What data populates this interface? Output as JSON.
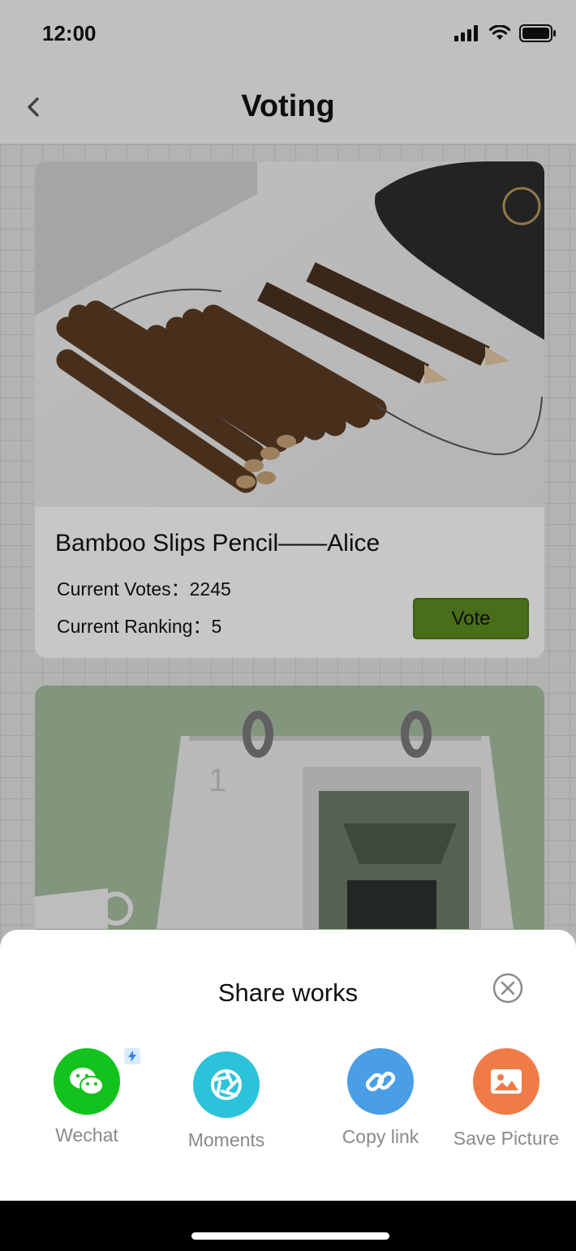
{
  "status_bar": {
    "time": "12:00"
  },
  "nav": {
    "title": "Voting"
  },
  "cards": [
    {
      "title": "Bamboo Slips Pencil——Alice",
      "votes_text": "Current Votes：2245",
      "ranking_text": "Current Ranking：5",
      "vote_label": "Vote"
    },
    {
      "image": "desk-calendar-photo"
    }
  ],
  "share_sheet": {
    "title": "Share works",
    "items": [
      {
        "label": "Wechat",
        "icon": "wechat-icon",
        "color": "#13c21c"
      },
      {
        "label": "Moments",
        "icon": "moments-icon",
        "color": "#2bc3d9"
      },
      {
        "label": "Copy link",
        "icon": "link-icon",
        "color": "#4a9ee6"
      },
      {
        "label": "Save Picture",
        "icon": "picture-icon",
        "color": "#ef7c47"
      }
    ]
  },
  "colors": {
    "vote_button": "#5e8e22"
  }
}
